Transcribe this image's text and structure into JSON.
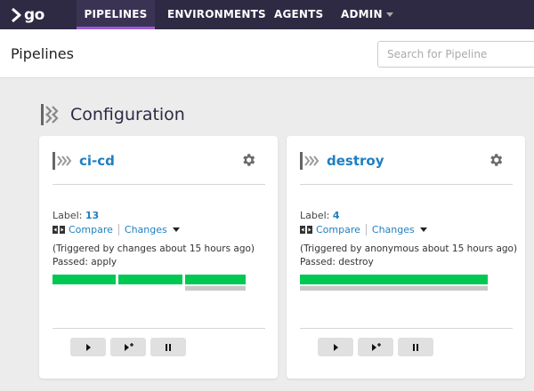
{
  "nav": {
    "logo_text": "go",
    "items": [
      {
        "label": "PIPELINES",
        "active": true
      },
      {
        "label": "ENVIRONMENTS",
        "active": false
      },
      {
        "label": "AGENTS",
        "active": false
      },
      {
        "label": "ADMIN",
        "active": false
      }
    ]
  },
  "header": {
    "title": "Pipelines",
    "search_placeholder": "Search for Pipeline"
  },
  "group": {
    "name": "Configuration",
    "icon": "pipeline-group-icon"
  },
  "pipelines": [
    {
      "name": "ci-cd",
      "label_text": "Label:",
      "label_value": "13",
      "compare": "Compare",
      "changes": "Changes",
      "triggered": "(Triggered by changes about 15 hours ago)",
      "passed": "Passed: apply",
      "stages": [
        "passed",
        "passed",
        "passed"
      ]
    },
    {
      "name": "destroy",
      "label_text": "Label:",
      "label_value": "4",
      "compare": "Compare",
      "changes": "Changes",
      "triggered": "(Triggered by anonymous about 15 hours ago)",
      "passed": "Passed: destroy",
      "stages": [
        "passed"
      ]
    }
  ],
  "colors": {
    "nav_bg": "#2f2a44",
    "active_underline": "#9b5bd7",
    "link": "#1f7fbf",
    "stage_passed": "#00c853"
  },
  "icons": {
    "trigger": "play-icon",
    "trigger_with_options": "play-plus-icon",
    "pause": "pause-icon",
    "settings": "gear-icon"
  }
}
